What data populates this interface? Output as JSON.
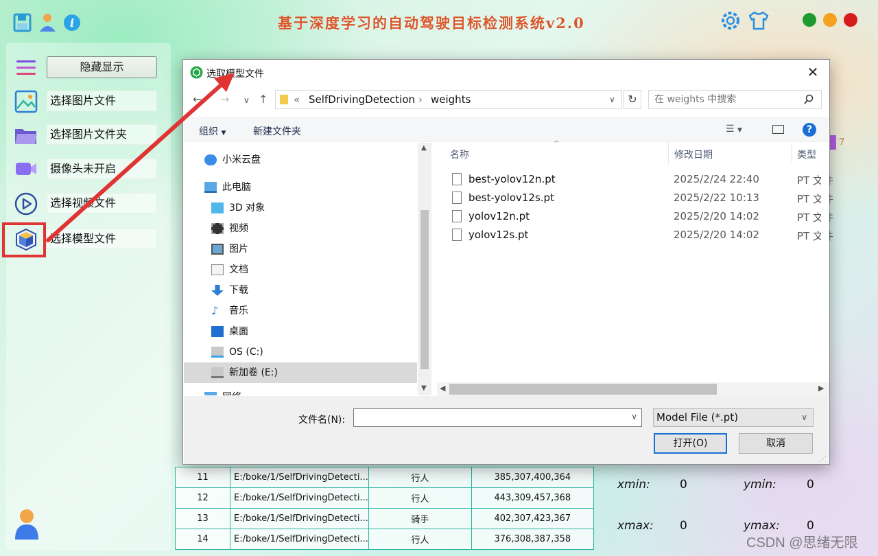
{
  "app": {
    "title": "基于深度学习的自动驾驶目标检测系统v2.0"
  },
  "sidebar": {
    "hide_label": "隐藏显示",
    "items": [
      {
        "label": "选择图片文件",
        "icon": "image-icon"
      },
      {
        "label": "选择图片文件夹",
        "icon": "folder-icon"
      },
      {
        "label": "摄像头未开启",
        "icon": "camera-icon"
      },
      {
        "label": "选择视频文件",
        "icon": "play-icon"
      },
      {
        "label": "选择模型文件",
        "icon": "model-cube-icon"
      }
    ]
  },
  "bg_table": {
    "rows": [
      {
        "id": "11",
        "path": "E:/boke/1/SelfDrivingDetecti...",
        "cls": "行人",
        "box": "385,307,400,364"
      },
      {
        "id": "12",
        "path": "E:/boke/1/SelfDrivingDetecti...",
        "cls": "行人",
        "box": "443,309,457,368"
      },
      {
        "id": "13",
        "path": "E:/boke/1/SelfDrivingDetecti...",
        "cls": "骑手",
        "box": "402,307,423,367"
      },
      {
        "id": "14",
        "path": "E:/boke/1/SelfDrivingDetecti...",
        "cls": "行人",
        "box": "376,308,387,358"
      }
    ]
  },
  "coords": {
    "xmin_label": "xmin:",
    "xmin": "0",
    "ymin_label": "ymin:",
    "ymin": "0",
    "xmax_label": "xmax:",
    "xmax": "0",
    "ymax_label": "ymax:",
    "ymax": "0"
  },
  "side_badge": "7",
  "dialog": {
    "title": "选取模型文件",
    "path_sep": "«",
    "path": [
      "SelfDrivingDetection",
      "weights"
    ],
    "search_placeholder": "在 weights 中搜索",
    "organize": "组织",
    "new_folder": "新建文件夹",
    "nav": [
      {
        "label": "小米云盘",
        "icon": "cloud-icon"
      },
      {
        "label": "此电脑",
        "icon": "computer-icon"
      },
      {
        "label": "3D 对象",
        "icon": "cube-3d-icon"
      },
      {
        "label": "视频",
        "icon": "video-icon"
      },
      {
        "label": "图片",
        "icon": "picture-icon"
      },
      {
        "label": "文档",
        "icon": "document-icon"
      },
      {
        "label": "下载",
        "icon": "download-icon"
      },
      {
        "label": "音乐",
        "icon": "music-icon"
      },
      {
        "label": "桌面",
        "icon": "desktop-icon"
      },
      {
        "label": "OS (C:)",
        "icon": "drive-c-icon"
      },
      {
        "label": "新加卷 (E:)",
        "icon": "drive-e-icon"
      },
      {
        "label": "网络",
        "icon": "network-icon"
      }
    ],
    "columns": {
      "name": "名称",
      "date": "修改日期",
      "type": "类型"
    },
    "files": [
      {
        "name": "best-yolov12n.pt",
        "date": "2025/2/24 22:40",
        "type": "PT 文件"
      },
      {
        "name": "best-yolov12s.pt",
        "date": "2025/2/22 10:13",
        "type": "PT 文件"
      },
      {
        "name": "yolov12n.pt",
        "date": "2025/2/20 14:02",
        "type": "PT 文件"
      },
      {
        "name": "yolov12s.pt",
        "date": "2025/2/20 14:02",
        "type": "PT 文件"
      }
    ],
    "filename_label": "文件名(N):",
    "filename_value": "",
    "filetype": "Model File (*.pt)",
    "open_label": "打开(O)",
    "cancel_label": "取消"
  },
  "watermark": "CSDN @思绪无限",
  "colors": {
    "title": "#d8572a",
    "accent_red": "#e03434",
    "dot_green": "#1f9a2e",
    "dot_orange": "#f4a11f",
    "dot_red": "#d81b1b",
    "table_border": "#2ab3a0"
  }
}
